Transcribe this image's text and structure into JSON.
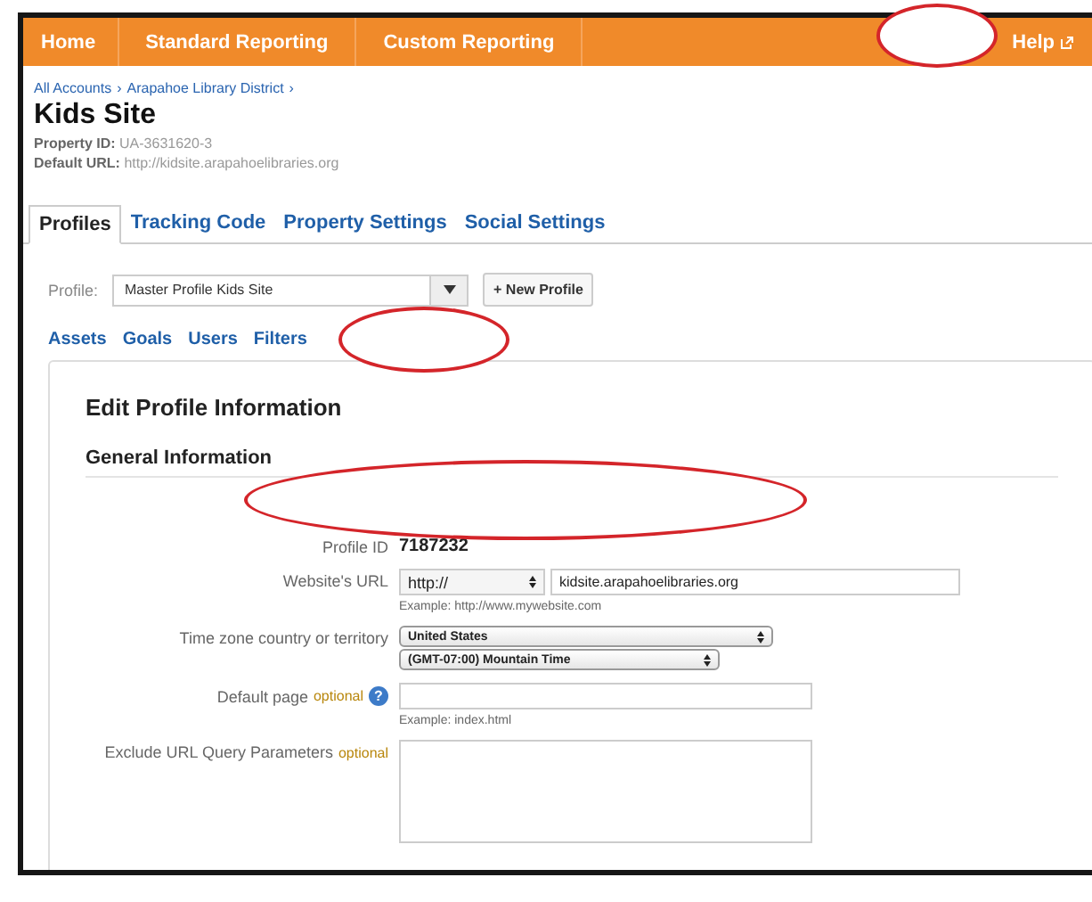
{
  "nav": {
    "items": [
      {
        "label": "Home"
      },
      {
        "label": "Standard Reporting"
      },
      {
        "label": "Custom Reporting"
      }
    ],
    "help": "Help"
  },
  "breadcrumb": {
    "items": [
      "All Accounts",
      "Arapahoe Library District"
    ],
    "separator": "›"
  },
  "title": "Kids Site",
  "meta": [
    {
      "label": "Property ID:",
      "value": "UA-3631620-3"
    },
    {
      "label": "Default URL:",
      "value": "http://kidsite.arapahoelibraries.org"
    }
  ],
  "tabs": [
    {
      "label": "Profiles",
      "selected": true
    },
    {
      "label": "Tracking Code",
      "selected": false
    },
    {
      "label": "Property Settings",
      "selected": false
    },
    {
      "label": "Social Settings",
      "selected": false
    }
  ],
  "profile": {
    "label": "Profile:",
    "value": "Master Profile Kids Site",
    "new_button": "+ New Profile"
  },
  "subtabs": [
    "Assets",
    "Goals",
    "Users",
    "Filters"
  ],
  "panel": {
    "title": "Edit Profile Information",
    "section": "General Information",
    "fields": [
      {
        "kind": "text",
        "label": "Profile ID",
        "value": "7187232"
      },
      {
        "kind": "url",
        "label": "Website's URL",
        "protocol": "http://",
        "value": "kidsite.arapahoelibraries.org",
        "hint": "Example: http://www.mywebsite.com"
      },
      {
        "kind": "selects",
        "label": "Time zone country or territory",
        "options": [
          "United States",
          "(GMT-07:00) Mountain Time"
        ]
      },
      {
        "kind": "input",
        "label": "Default page",
        "optional": "optional",
        "help": "?",
        "hint": "Example: index.html"
      },
      {
        "kind": "textarea",
        "label": "Exclude URL Query Parameters",
        "optional": "optional"
      }
    ]
  }
}
